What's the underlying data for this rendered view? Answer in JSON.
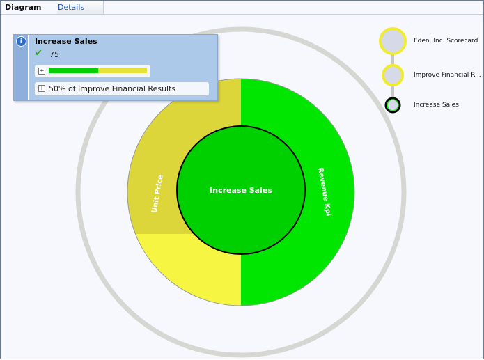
{
  "tabs": [
    {
      "label": "Diagram",
      "active": true
    },
    {
      "label": "Details",
      "active": false
    }
  ],
  "diagram": {
    "center_label": "Increase Sales",
    "segments": [
      {
        "label": "Unit Price",
        "color": "#dcd63a"
      },
      {
        "label": "Revenue Kpi",
        "color": "#00e600"
      }
    ]
  },
  "popup": {
    "title": "Increase Sales",
    "value": "75",
    "progress": 0.5,
    "contribution": "50% of Improve Financial Results"
  },
  "breadcrumb": [
    {
      "label": "Eden, Inc. Scorecard",
      "status": "yellow"
    },
    {
      "label": "Improve Financial R...",
      "status": "yellow"
    },
    {
      "label": "Increase Sales",
      "status": "green"
    }
  ]
}
